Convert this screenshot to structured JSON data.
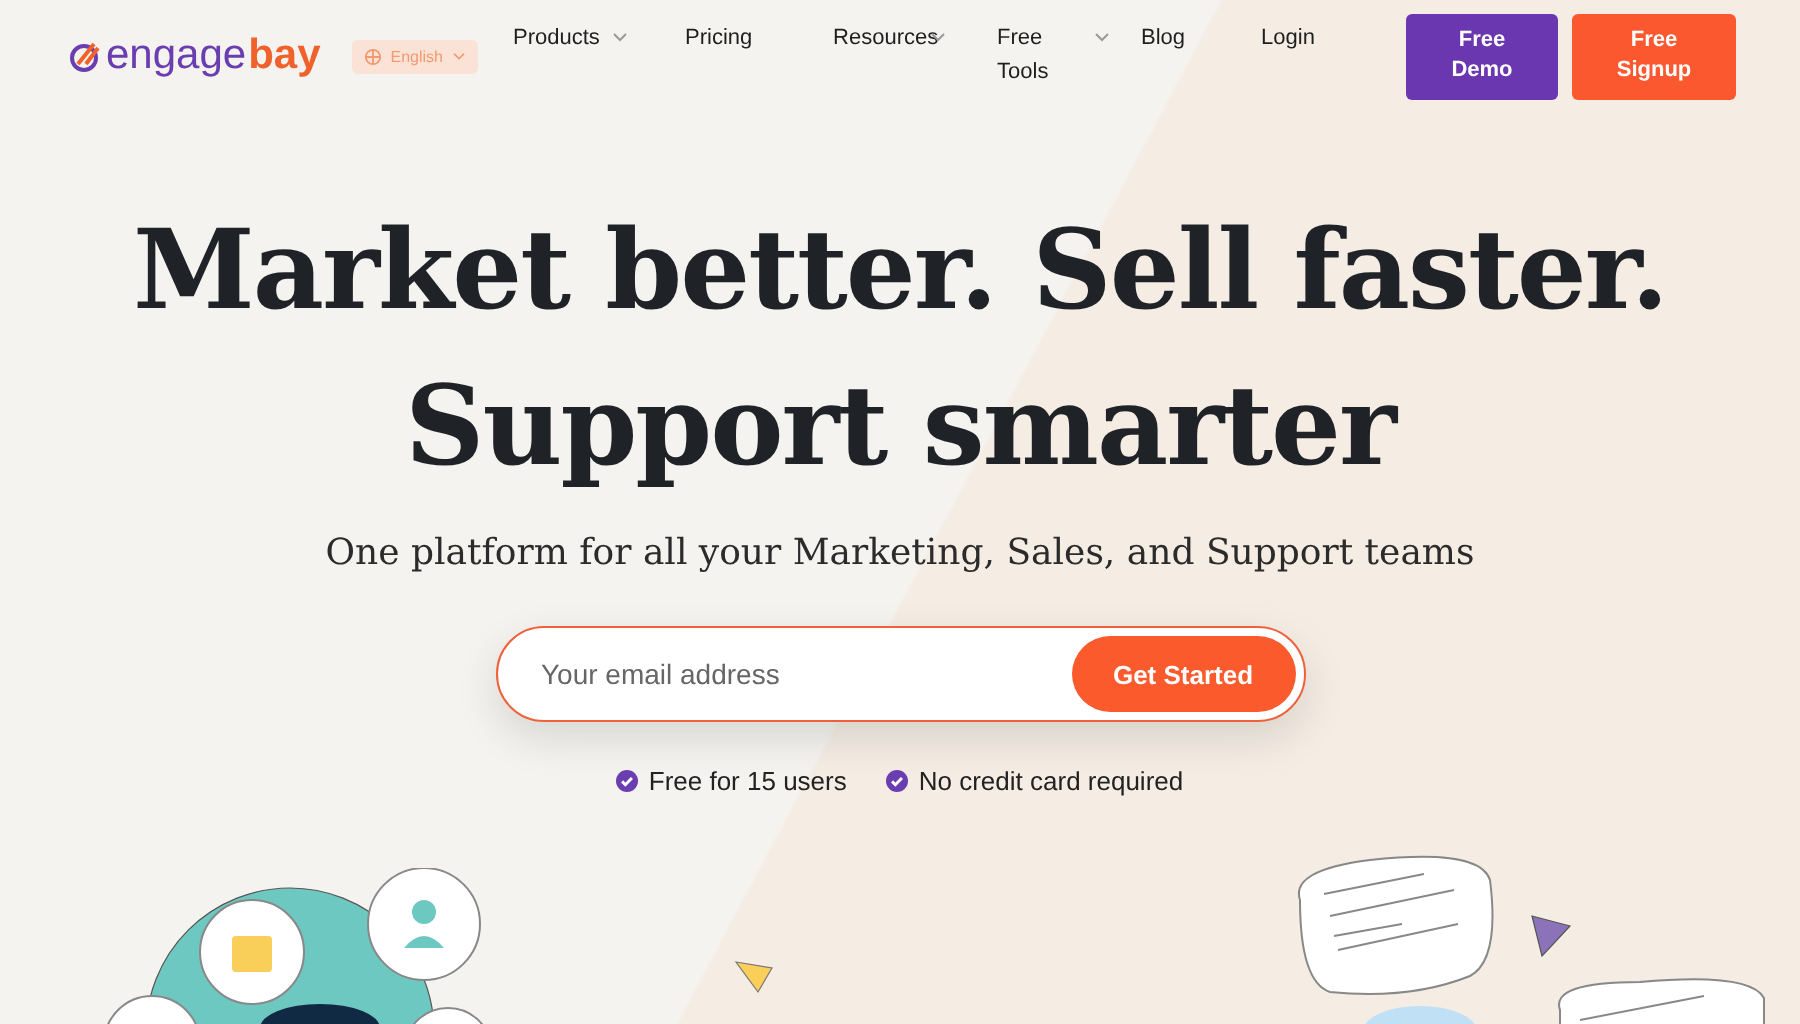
{
  "header": {
    "logo": {
      "primary": "engage",
      "accent": "bay"
    },
    "language": {
      "label": "English"
    },
    "nav": [
      {
        "label": "Products",
        "has_menu": true
      },
      {
        "label": "Pricing",
        "has_menu": false
      },
      {
        "label": "Resources",
        "has_menu": true
      },
      {
        "label": "Free Tools",
        "has_menu": true
      },
      {
        "label": "Blog",
        "has_menu": false
      },
      {
        "label": "Login",
        "has_menu": false
      }
    ],
    "buttons": [
      {
        "label": "Free Demo",
        "kind": "demo"
      },
      {
        "label": "Free Signup",
        "kind": "signup"
      }
    ]
  },
  "hero": {
    "headline": [
      "Market better. Sell faster.",
      "Support smarter"
    ],
    "subtitle": "One platform for all your Marketing, Sales, and Support teams",
    "signup": {
      "placeholder": "Your email address",
      "button": "Get Started"
    },
    "perks": [
      "Free for 15 users",
      "No credit card required"
    ]
  }
}
